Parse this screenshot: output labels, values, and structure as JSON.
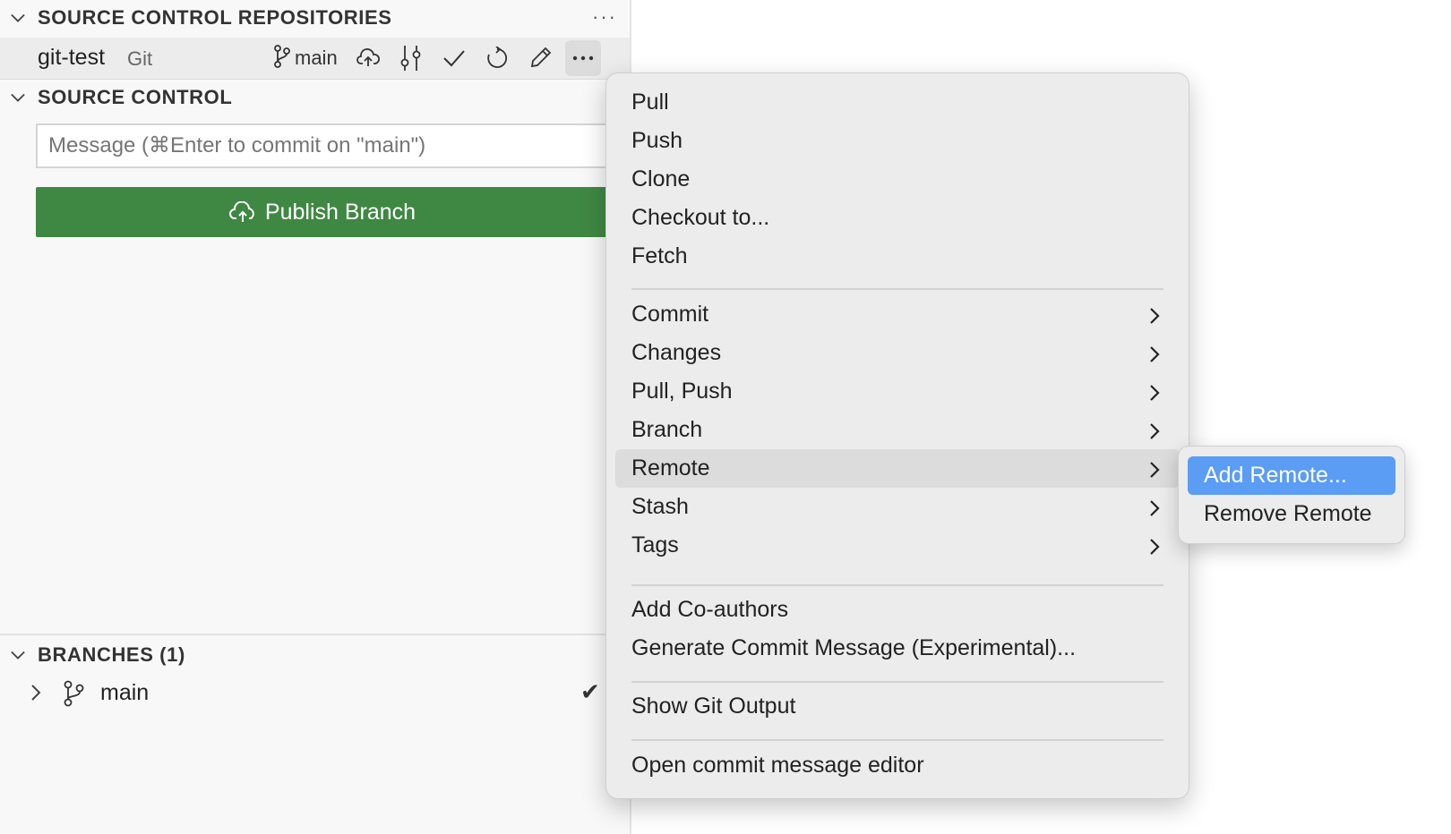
{
  "sidebar": {
    "repositories_header": "SOURCE CONTROL REPOSITORIES",
    "repositories_more": "···",
    "repo": {
      "name": "git-test",
      "kind": "Git",
      "branch": "main"
    },
    "source_control_header": "SOURCE CONTROL",
    "commit_message": {
      "value": "",
      "placeholder": "Message (⌘Enter to commit on \"main\")"
    },
    "publish_button": "Publish Branch",
    "branches_header": "BRANCHES (1)",
    "branches": [
      {
        "name": "main",
        "current_mark": "✔"
      }
    ]
  },
  "context_menu": {
    "group1": [
      "Pull",
      "Push",
      "Clone",
      "Checkout to...",
      "Fetch"
    ],
    "group2": [
      "Commit",
      "Changes",
      "Pull, Push",
      "Branch",
      "Remote",
      "Stash",
      "Tags"
    ],
    "hovered": "Remote",
    "group3": [
      "Add Co-authors",
      "Generate Commit Message (Experimental)..."
    ],
    "group4": [
      "Show Git Output"
    ],
    "group5": [
      "Open commit message editor"
    ]
  },
  "submenu": {
    "items": [
      "Add Remote...",
      "Remove Remote"
    ],
    "selected": "Add Remote..."
  },
  "colors": {
    "publish_button": "#3f8843",
    "selected_item": "#5b9cf5",
    "menu_background": "#ececec"
  }
}
